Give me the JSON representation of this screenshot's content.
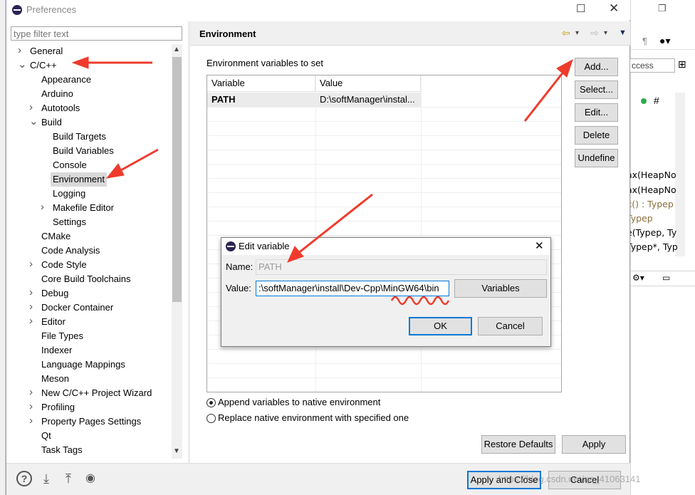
{
  "window": {
    "title": "Preferences"
  },
  "filter": {
    "placeholder": "type filter text"
  },
  "tree": [
    {
      "label": "General",
      "level": 0,
      "expander": "collapsed"
    },
    {
      "label": "C/C++",
      "level": 0,
      "expander": "expanded"
    },
    {
      "label": "Appearance",
      "level": 1,
      "expander": "none"
    },
    {
      "label": "Arduino",
      "level": 1,
      "expander": "none"
    },
    {
      "label": "Autotools",
      "level": 1,
      "expander": "collapsed"
    },
    {
      "label": "Build",
      "level": 1,
      "expander": "expanded"
    },
    {
      "label": "Build Targets",
      "level": 2,
      "expander": "none"
    },
    {
      "label": "Build Variables",
      "level": 2,
      "expander": "none"
    },
    {
      "label": "Console",
      "level": 2,
      "expander": "none"
    },
    {
      "label": "Environment",
      "level": 2,
      "expander": "none",
      "selected": true
    },
    {
      "label": "Logging",
      "level": 2,
      "expander": "none"
    },
    {
      "label": "Makefile Editor",
      "level": 2,
      "expander": "collapsed"
    },
    {
      "label": "Settings",
      "level": 2,
      "expander": "none"
    },
    {
      "label": "CMake",
      "level": 1,
      "expander": "none"
    },
    {
      "label": "Code Analysis",
      "level": 1,
      "expander": "none"
    },
    {
      "label": "Code Style",
      "level": 1,
      "expander": "collapsed"
    },
    {
      "label": "Core Build Toolchains",
      "level": 1,
      "expander": "none"
    },
    {
      "label": "Debug",
      "level": 1,
      "expander": "collapsed"
    },
    {
      "label": "Docker Container",
      "level": 1,
      "expander": "collapsed"
    },
    {
      "label": "Editor",
      "level": 1,
      "expander": "collapsed"
    },
    {
      "label": "File Types",
      "level": 1,
      "expander": "none"
    },
    {
      "label": "Indexer",
      "level": 1,
      "expander": "none"
    },
    {
      "label": "Language Mappings",
      "level": 1,
      "expander": "none"
    },
    {
      "label": "Meson",
      "level": 1,
      "expander": "none"
    },
    {
      "label": "New C/C++ Project Wizard",
      "level": 1,
      "expander": "collapsed"
    },
    {
      "label": "Profiling",
      "level": 1,
      "expander": "collapsed"
    },
    {
      "label": "Property Pages Settings",
      "level": 1,
      "expander": "collapsed"
    },
    {
      "label": "Qt",
      "level": 1,
      "expander": "none"
    },
    {
      "label": "Task Tags",
      "level": 1,
      "expander": "none"
    }
  ],
  "panel": {
    "title": "Environment",
    "env_label": "Environment variables to set",
    "columns": [
      "Variable",
      "Value"
    ],
    "rows": [
      {
        "variable": "PATH",
        "value": "D:\\softManager\\instal..."
      }
    ],
    "buttons": {
      "add": "Add...",
      "select": "Select...",
      "edit": "Edit...",
      "delete": "Delete",
      "undefine": "Undefine"
    },
    "radio_append": "Append variables to native environment",
    "radio_replace": "Replace native environment with specified one",
    "restore_defaults": "Restore Defaults",
    "apply": "Apply"
  },
  "footer": {
    "apply_and_close": "Apply and Close",
    "cancel": "Cancel"
  },
  "dialog": {
    "title": "Edit variable",
    "name_label": "Name:",
    "name_value": "PATH",
    "value_label": "Value:",
    "value_value": ":\\softManager\\install\\Dev-Cpp\\MinGW64\\bin",
    "variables_button": "Variables",
    "ok": "OK",
    "cancel": "Cancel"
  },
  "background_code": [
    {
      "text": "ax(HeapNo",
      "color": "#000000"
    },
    {
      "text": "ax(HeapNo",
      "color": "#000000"
    },
    {
      "text": "k() : Typep",
      "color": "#8a6d3b"
    },
    {
      "text": "Typep",
      "color": "#8a6d3b"
    },
    {
      "text": "e(Typep, Ty",
      "color": "#000000"
    },
    {
      "text": "Typep*, Typ",
      "color": "#000000"
    }
  ],
  "background_misc": {
    "access": "ccess"
  },
  "watermark": "https://blog.csdn.net/qq_41063141"
}
